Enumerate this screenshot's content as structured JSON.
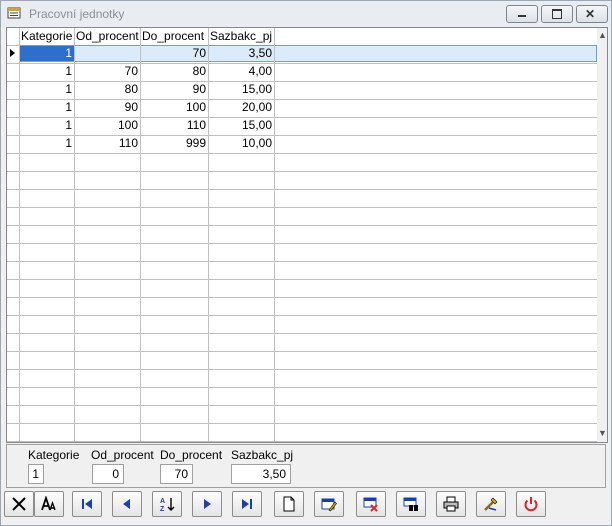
{
  "window": {
    "title": "Pracovní jednotky"
  },
  "grid": {
    "columns": [
      "Kategorie",
      "Od_procent",
      "Do_procent",
      "Sazbakc_pj"
    ],
    "rows": [
      [
        "1",
        "",
        "70",
        "3,50"
      ],
      [
        "1",
        "70",
        "80",
        "4,00"
      ],
      [
        "1",
        "80",
        "90",
        "15,00"
      ],
      [
        "1",
        "90",
        "100",
        "20,00"
      ],
      [
        "1",
        "100",
        "110",
        "15,00"
      ],
      [
        "1",
        "110",
        "999",
        "10,00"
      ]
    ]
  },
  "edit": {
    "kategorie": {
      "label": "Kategorie",
      "value": "1"
    },
    "od_procent": {
      "label": "Od_procent",
      "value": "0"
    },
    "do_procent": {
      "label": "Do_procent",
      "value": "70"
    },
    "sazbakc_pj": {
      "label": "Sazbakc_pj",
      "value": "3,50"
    }
  },
  "toolbar": {
    "buttons": [
      {
        "icon": "close-x-icon"
      },
      {
        "icon": "font-icon"
      },
      {
        "icon": "first-record-icon"
      },
      {
        "icon": "previous-record-icon"
      },
      {
        "icon": "sort-az-icon"
      },
      {
        "icon": "next-record-icon"
      },
      {
        "icon": "last-record-icon"
      },
      {
        "icon": "new-record-icon"
      },
      {
        "icon": "edit-record-icon"
      },
      {
        "icon": "delete-record-icon"
      },
      {
        "icon": "find-icon"
      },
      {
        "icon": "print-icon"
      },
      {
        "icon": "tools-icon"
      },
      {
        "icon": "power-icon"
      }
    ]
  },
  "colors": {
    "selection": "#2f6fc9",
    "exit": "#d22b2b",
    "nav": "#1f3fa8"
  }
}
